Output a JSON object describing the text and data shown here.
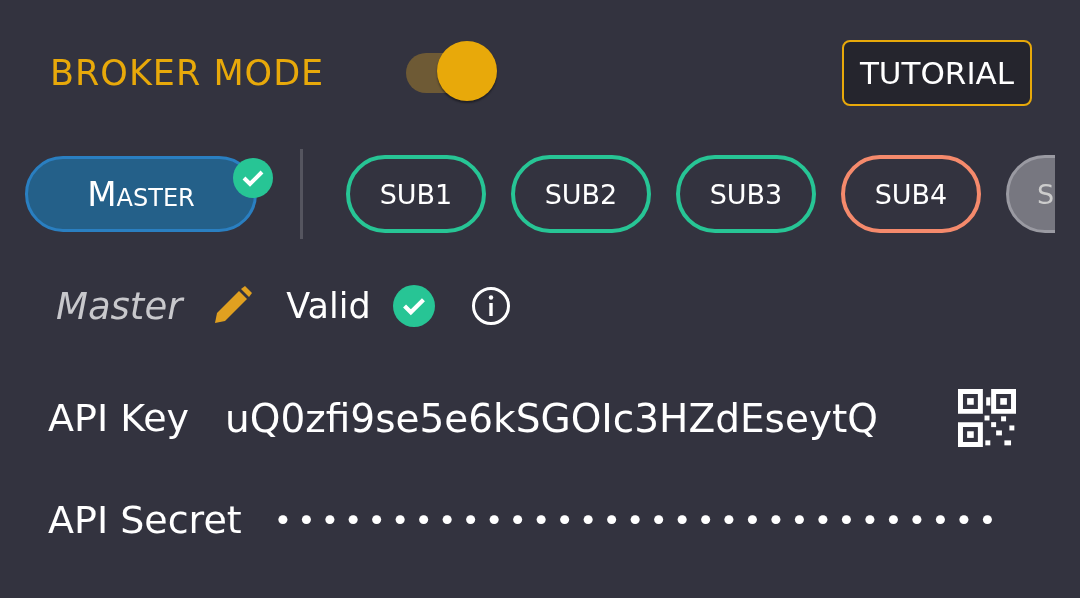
{
  "broker_mode": {
    "label": "BROKER MODE",
    "on": true
  },
  "tutorial_button": "TUTORIAL",
  "accounts": [
    {
      "label": "Master",
      "selected": true,
      "valid": true,
      "disabled": false,
      "color": "#2a7fc1"
    },
    {
      "label": "SUB1",
      "selected": false,
      "valid": false,
      "disabled": false,
      "color": "#27c595"
    },
    {
      "label": "SUB2",
      "selected": false,
      "valid": false,
      "disabled": false,
      "color": "#27c595"
    },
    {
      "label": "SUB3",
      "selected": false,
      "valid": false,
      "disabled": false,
      "color": "#27c595"
    },
    {
      "label": "SUB4",
      "selected": false,
      "valid": false,
      "disabled": false,
      "color": "#f58a6c"
    },
    {
      "label": "S",
      "selected": false,
      "valid": false,
      "disabled": true,
      "color": "#9a9aa2"
    }
  ],
  "account_detail": {
    "name": "Master",
    "status": "Valid",
    "valid": true
  },
  "fields": [
    {
      "kind": "text",
      "label": "API Key",
      "value": "uQ0zfi9se5e6kSGOIc3HZdEseytQ"
    },
    {
      "kind": "secret",
      "label": "API Secret",
      "value": "•••••••••••••••••••••••••••••••"
    }
  ]
}
